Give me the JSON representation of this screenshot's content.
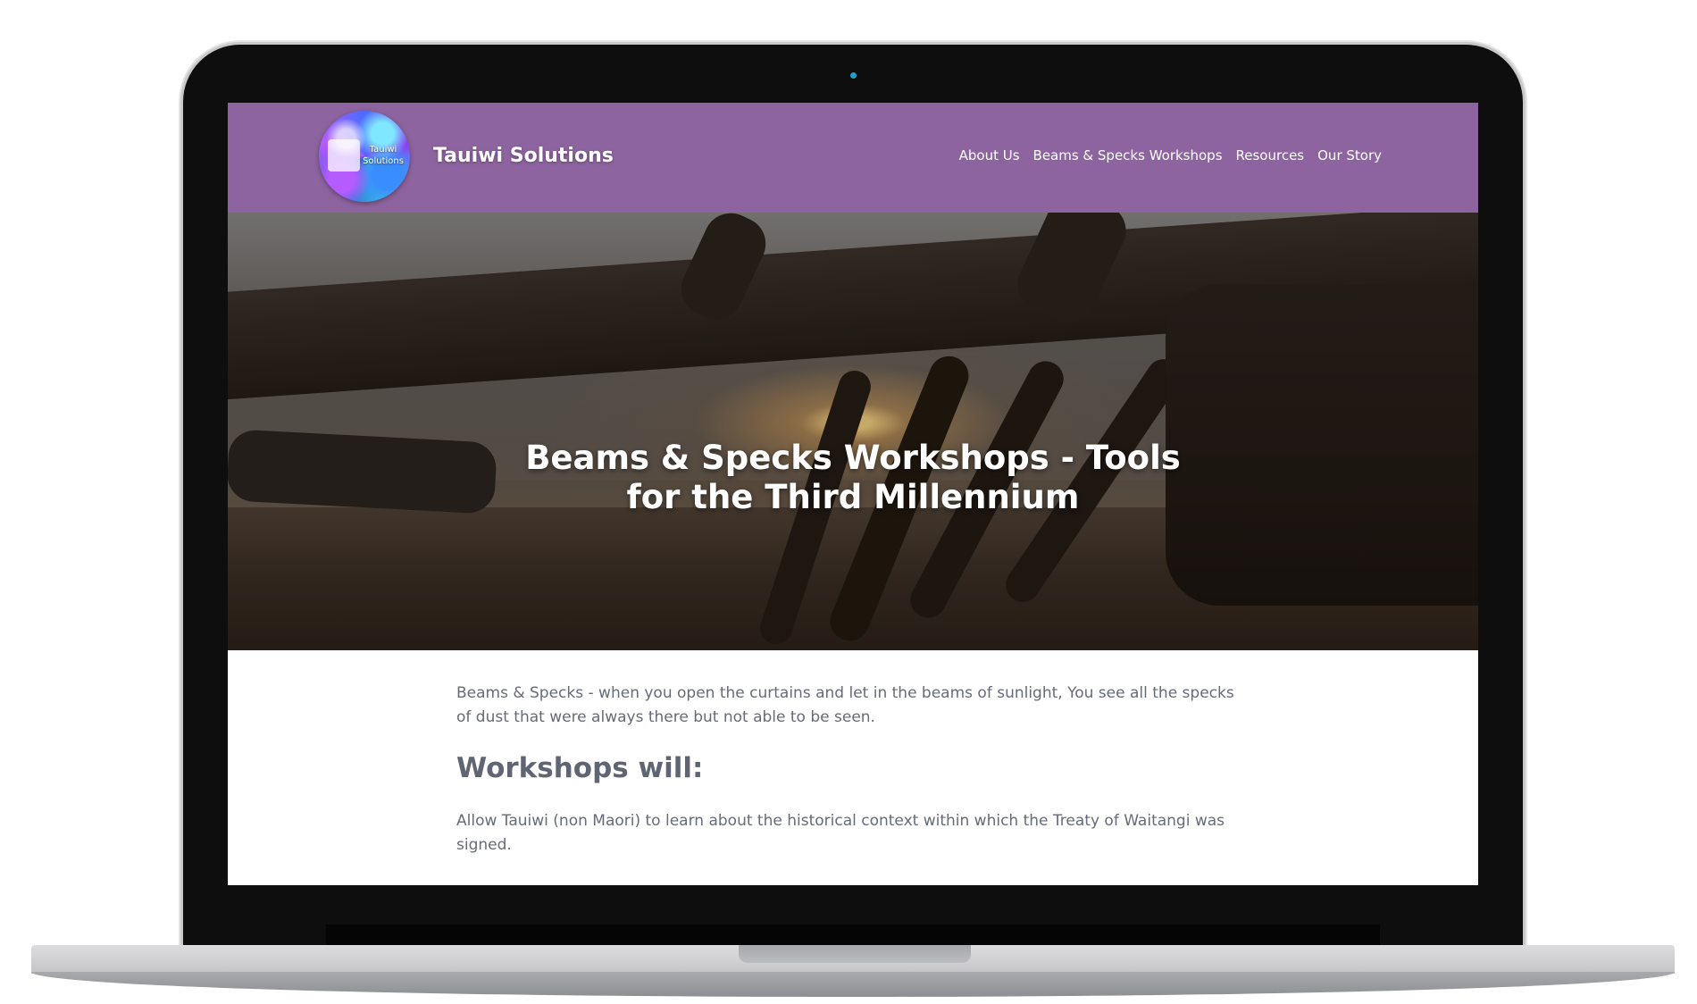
{
  "site": {
    "logo_text_line1": "Tauiwi",
    "logo_text_line2": "Solutions",
    "title": "Tauiwi Solutions",
    "nav": [
      "About Us",
      "Beams & Specks Workshops",
      "Resources",
      "Our Story"
    ]
  },
  "hero": {
    "title": "Beams & Specks Workshops - Tools for the Third Millennium"
  },
  "content": {
    "intro": "Beams & Specks - when you open the curtains and let in the beams of sunlight, You see all the specks of dust that were always there but not able to be seen.",
    "heading": "Workshops will:",
    "item1": "Allow Tauiwi (non Maori) to learn about the historical context within which the Treaty of Waitangi was signed."
  },
  "colors": {
    "header_bg": "#8d649f",
    "text": "#666b78",
    "heading": "#5f6573"
  },
  "icons": {
    "camera": "camera-dot-icon"
  }
}
